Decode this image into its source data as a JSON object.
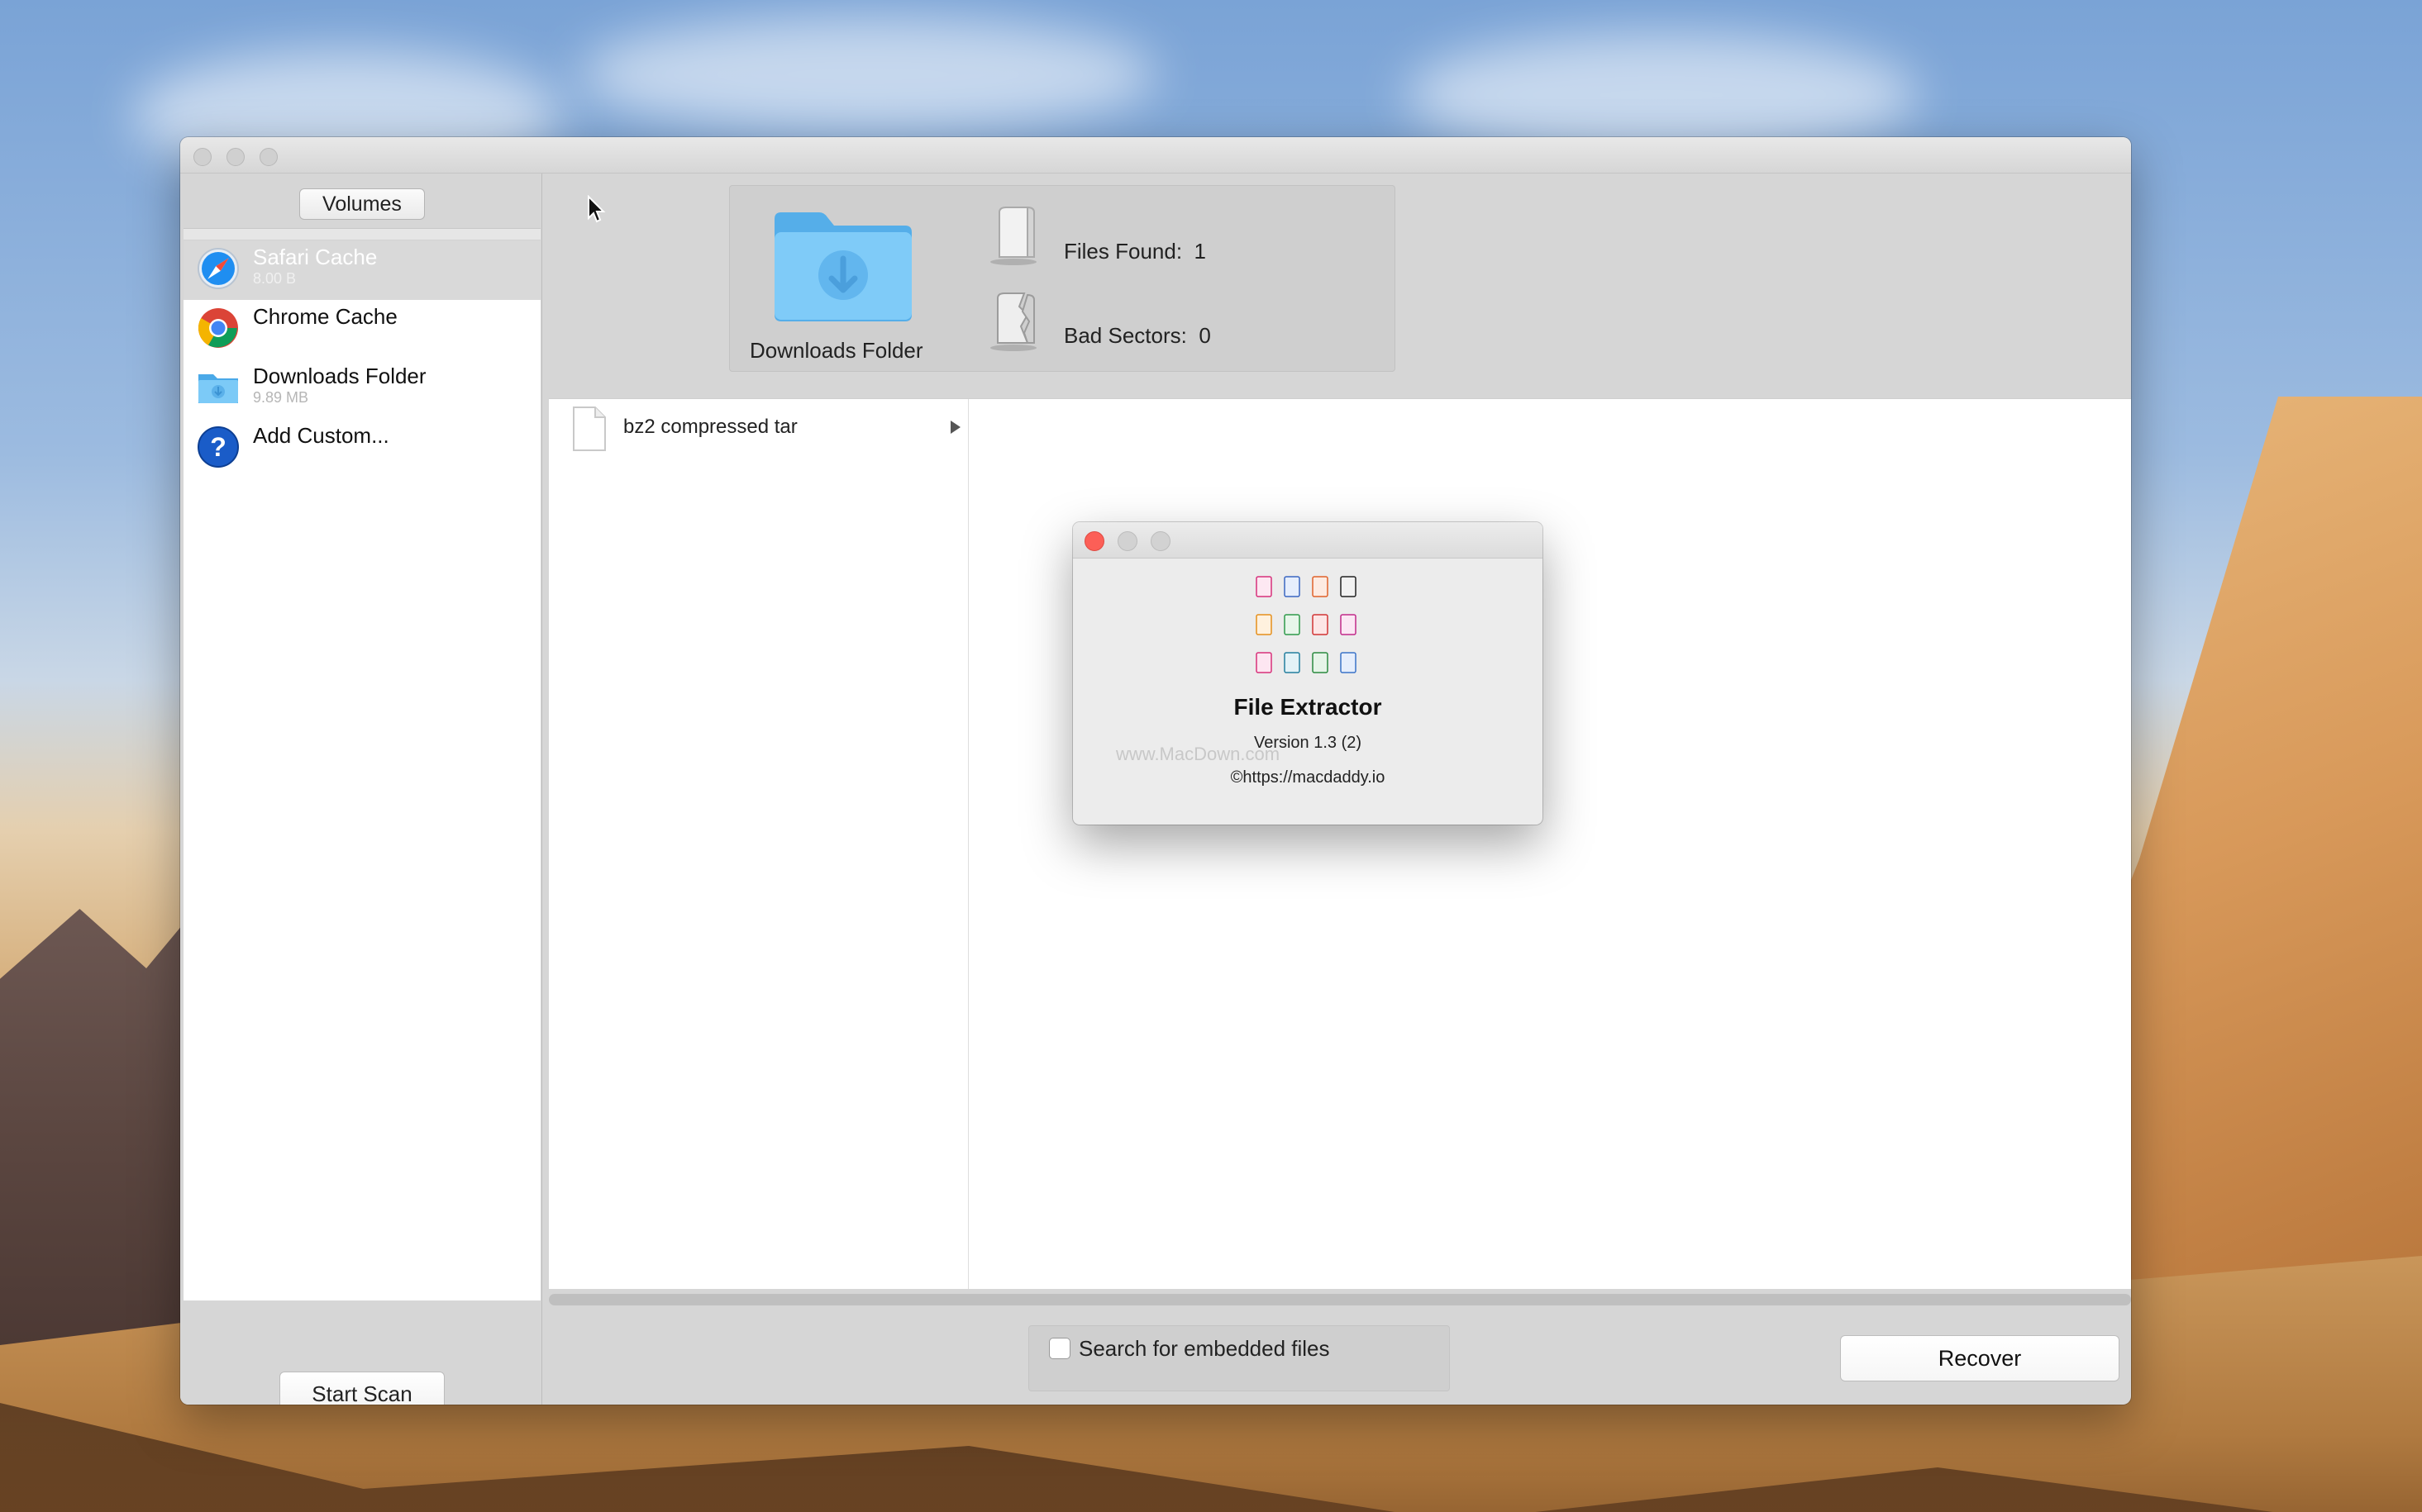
{
  "window": {
    "sidebar": {
      "header_label": "Volumes",
      "items": [
        {
          "name": "Safari Cache",
          "size": "8.00 B",
          "icon": "safari-icon",
          "selected": true
        },
        {
          "name": "Chrome Cache",
          "size": "",
          "icon": "chrome-icon",
          "selected": false
        },
        {
          "name": "Downloads Folder",
          "size": "9.89 MB",
          "icon": "downloads-folder-icon",
          "selected": false
        },
        {
          "name": "Add Custom...",
          "size": "",
          "icon": "question-icon",
          "selected": false
        }
      ],
      "start_scan_label": "Start Scan"
    },
    "info_panel": {
      "folder_label": "Downloads Folder",
      "files_found_label": "Files Found:",
      "files_found_value": "1",
      "bad_sectors_label": "Bad Sectors:",
      "bad_sectors_value": "0"
    },
    "file_list": {
      "rows": [
        {
          "name": "bz2 compressed tar",
          "icon": "document-icon"
        }
      ]
    },
    "options": {
      "embedded_label": "Search for embedded files",
      "embedded_checked": false
    },
    "recover_label": "Recover"
  },
  "about": {
    "title": "File Extractor",
    "version": "Version 1.3 (2)",
    "copyright": "©https://macdaddy.io",
    "watermark": "www.MacDown.com"
  },
  "colors": {
    "close_red": "#fc5f57",
    "folder_blue": "#5bb8f2",
    "safari_blue": "#1f8ef1"
  }
}
